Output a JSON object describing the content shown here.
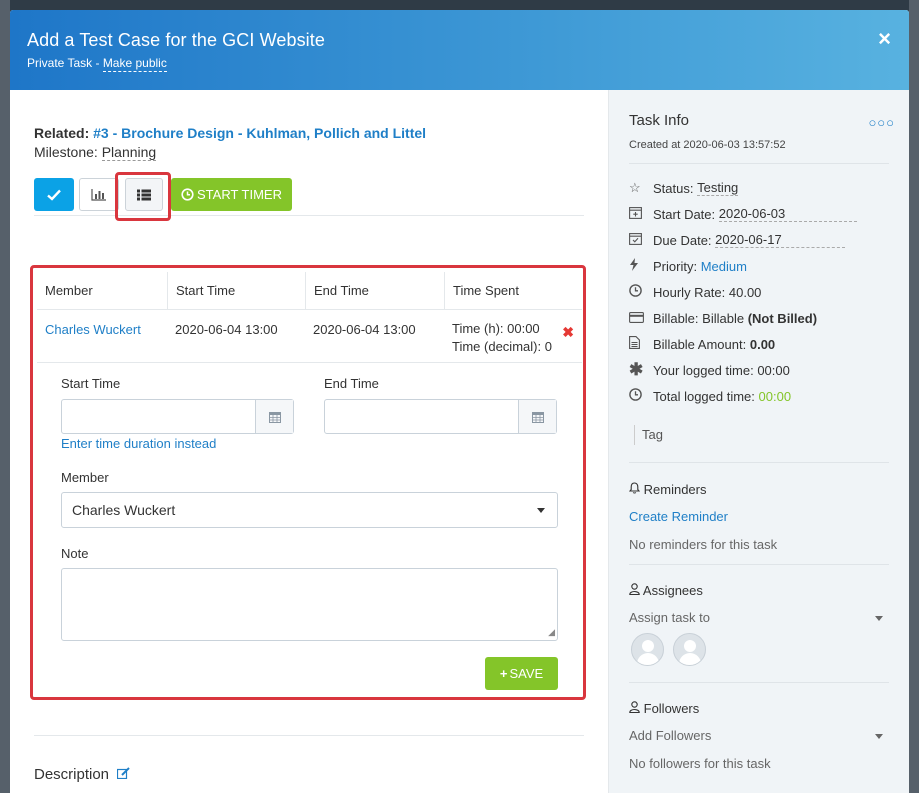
{
  "header": {
    "title": "Add a Test Case for the GCI Website",
    "privacy": "Private Task",
    "separator": " - ",
    "make_public": "Make public",
    "close": "×"
  },
  "related": {
    "label": "Related:",
    "link": "#3 - Brochure Design - Kuhlman, Pollich and Littel"
  },
  "milestone": {
    "label": "Milestone:",
    "value": "Planning"
  },
  "toolbar": {
    "start_timer": "START TIMER",
    "icons": [
      "check-icon",
      "bar-chart-icon",
      "list-icon",
      "clock-icon"
    ]
  },
  "timesheet": {
    "columns": [
      "Member",
      "Start Time",
      "End Time",
      "Time Spent"
    ],
    "rows": [
      {
        "member": "Charles Wuckert",
        "start": "2020-06-04 13:00",
        "end": "2020-06-04 13:00",
        "spent_h": "Time (h): 00:00",
        "spent_decimal": "Time (decimal): 0"
      }
    ],
    "delete": "✖"
  },
  "form": {
    "start_label": "Start Time",
    "end_label": "End Time",
    "start_value": "",
    "end_value": "",
    "duration_link": "Enter time duration instead",
    "member_label": "Member",
    "member_value": "Charles Wuckert",
    "note_label": "Note",
    "note_value": "",
    "save": "SAVE"
  },
  "description": {
    "label": "Description"
  },
  "task_info": {
    "title": "Task Info",
    "dots": "○○○",
    "created": "Created at 2020-06-03 13:57:52",
    "status_label": "Status:",
    "status_value": "Testing",
    "start_label": "Start Date:",
    "start_value": "2020-06-03",
    "due_label": "Due Date:",
    "due_value": "2020-06-17",
    "priority_label": "Priority:",
    "priority_value": "Medium",
    "rate_label": "Hourly Rate:",
    "rate_value": "40.00",
    "billable_label": "Billable:",
    "billable_value": "Billable",
    "billed_state": "(Not Billed)",
    "amount_label": "Billable Amount:",
    "amount_value": "0.00",
    "your_time_label": "Your logged time:",
    "your_time_value": "00:00",
    "total_time_label": "Total logged time:",
    "total_time_value": "00:00",
    "tag_placeholder": "Tag"
  },
  "reminders": {
    "title": "Reminders",
    "create": "Create Reminder",
    "empty": "No reminders for this task"
  },
  "assignees": {
    "title": "Assignees",
    "placeholder": "Assign task to"
  },
  "followers": {
    "title": "Followers",
    "placeholder": "Add Followers",
    "empty": "No followers for this task"
  }
}
